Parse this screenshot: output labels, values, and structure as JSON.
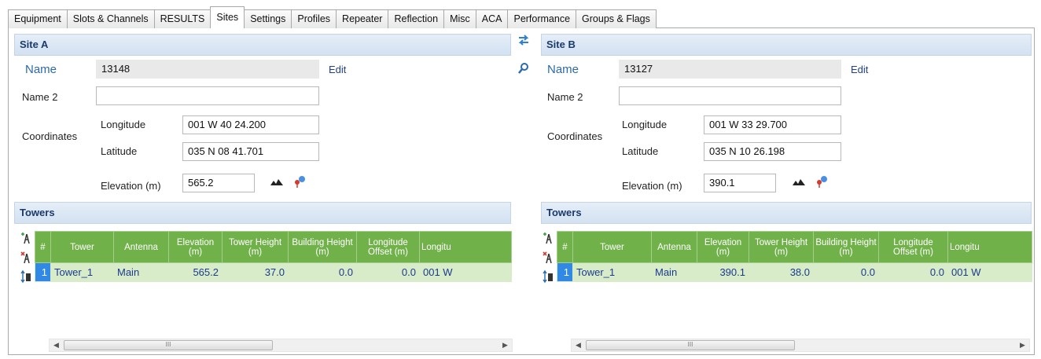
{
  "tabs": [
    {
      "label": "Equipment"
    },
    {
      "label": "Slots & Channels"
    },
    {
      "label": "RESULTS"
    },
    {
      "label": "Sites",
      "active": true
    },
    {
      "label": "Settings"
    },
    {
      "label": "Profiles"
    },
    {
      "label": "Repeater"
    },
    {
      "label": "Reflection"
    },
    {
      "label": "Misc"
    },
    {
      "label": "ACA"
    },
    {
      "label": "Performance"
    },
    {
      "label": "Groups & Flags"
    }
  ],
  "labels": {
    "name": "Name",
    "name2": "Name 2",
    "coordinates": "Coordinates",
    "longitude": "Longitude",
    "latitude": "Latitude",
    "elevation": "Elevation (m)",
    "edit": "Edit",
    "towers": "Towers"
  },
  "columns": [
    "#",
    "Tower",
    "Antenna",
    "Elevation (m)",
    "Tower Height (m)",
    "Building Height (m)",
    "Longitude Offset (m)",
    "Longitu"
  ],
  "site_a": {
    "title": "Site A",
    "name": "13148",
    "name2": "",
    "longitude": "001 W 40 24.200",
    "latitude": "035 N 08 41.701",
    "elevation": "565.2",
    "towers": [
      {
        "index": "1",
        "tower": "Tower_1",
        "antenna": "Main",
        "elevation": "565.2",
        "tower_height": "37.0",
        "building_height": "0.0",
        "longitude_offset": "0.0",
        "longitude": "001 W"
      }
    ]
  },
  "site_b": {
    "title": "Site B",
    "name": "13127",
    "name2": "",
    "longitude": "001 W 33 29.700",
    "latitude": "035 N 10 26.198",
    "elevation": "390.1",
    "towers": [
      {
        "index": "1",
        "tower": "Tower_1",
        "antenna": "Main",
        "elevation": "390.1",
        "tower_height": "38.0",
        "building_height": "0.0",
        "longitude_offset": "0.0",
        "longitude": "001 W"
      }
    ]
  },
  "scrollbar_grip": "III",
  "icons": {
    "swap": "swap-sites-icon",
    "search": "search-icon",
    "profile": "terrain-profile-icon",
    "map_pin": "map-pin-icon",
    "add_tower": "add-tower-icon",
    "delete_tower": "delete-tower-icon",
    "move_tower": "move-tower-icon"
  },
  "colors": {
    "header_blue": "#d3e1f1",
    "grid_header_green": "#71b14a",
    "grid_row_green": "#d9ecc9",
    "row_selected_blue": "#2f89e5",
    "name_label_blue": "#2a6aad"
  }
}
